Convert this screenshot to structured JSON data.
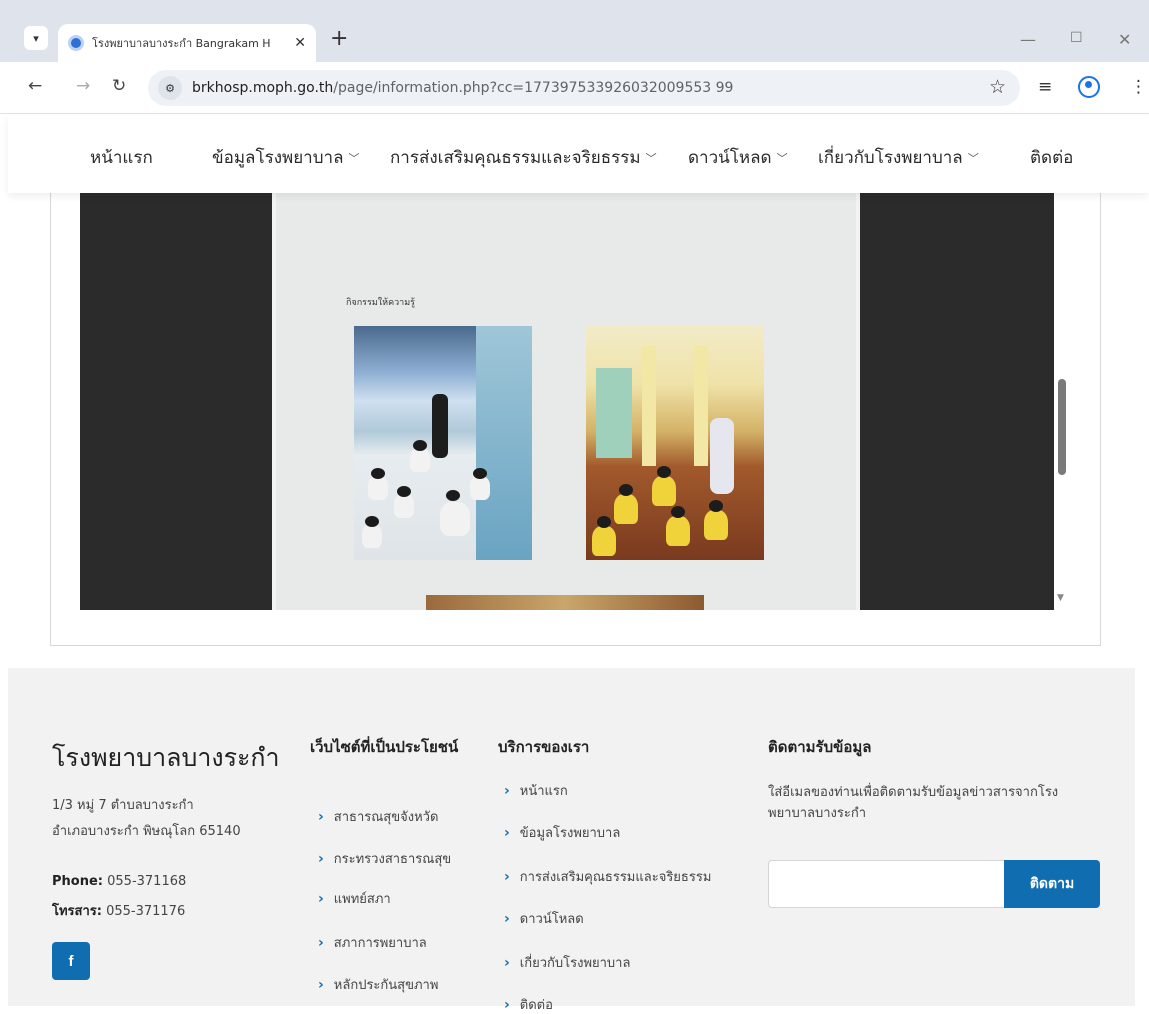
{
  "browser": {
    "tab_title": "โรงพยาบาลบางระกำ Bangrakam H",
    "new_tab_label": "+",
    "url_host": "brkhosp.moph.go.th",
    "url_path": "/page/information.php?cc=177397533926032009553 99"
  },
  "nav": {
    "items": [
      {
        "label": "หน้าแรก",
        "dropdown": false
      },
      {
        "label": "ข้อมูลโรงพยาบาล",
        "dropdown": true
      },
      {
        "label": "การส่งเสริมคุณธรรมและจริยธรรม",
        "dropdown": true
      },
      {
        "label": "ดาวน์โหลด",
        "dropdown": true
      },
      {
        "label": "เกี่ยวกับโรงพยาบาล",
        "dropdown": true
      },
      {
        "label": "ติดต่อ",
        "dropdown": false
      }
    ]
  },
  "document": {
    "page_heading": "กิจกรรมให้ความรู้"
  },
  "footer": {
    "brand": "โรงพยาบาลบางระกำ",
    "address_line1": "1/3 หมู่ 7 ตำบลบางระกำ",
    "address_line2": "อำเภอบางระกำ พิษณุโลก 65140",
    "phone_label": "Phone:",
    "phone_value": "055-371168",
    "fax_label": "โทรสาร:",
    "fax_value": "055-371176",
    "facebook_label": "f",
    "useful_sites": {
      "heading": "เว็บไซต์ที่เป็นประโยชน์",
      "links": [
        "สาธารณสุขจังหวัด",
        "กระทรวงสาธารณสุข",
        "แพทย์สภา",
        "สภาการพยาบาล",
        "หลักประกันสุขภาพ"
      ]
    },
    "services": {
      "heading": "บริการของเรา",
      "links": [
        "หน้าแรก",
        "ข้อมูลโรงพยาบาล",
        "การส่งเสริมคุณธรรมและจริยธรรม",
        "ดาวน์โหลด",
        "เกี่ยวกับโรงพยาบาล",
        "ติดต่อ"
      ]
    },
    "subscribe": {
      "heading": "ติดตามรับข้อมูล",
      "text": "ใส่อีเมลของท่านเพื่อติดตามรับข้อมูลข่าวสารจากโรงพยาบาลบางระกำ",
      "input_value": "",
      "button": "ติดตาม"
    }
  },
  "colors": {
    "accent": "#106eb0",
    "pdf_background": "#2b2b2b",
    "footer_background": "#f2f2f2"
  }
}
